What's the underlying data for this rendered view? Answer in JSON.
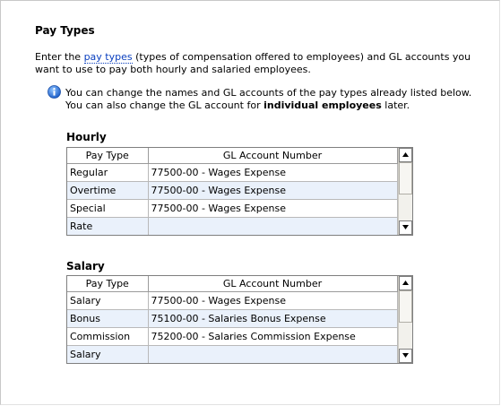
{
  "page": {
    "title": "Pay Types",
    "intro_before_link": "Enter the ",
    "intro_link": "pay types",
    "intro_after_link": " (types of compensation offered to employees) and GL accounts you want to use to pay both hourly and salaried employees.",
    "info_before_bold": "You can change the names and GL accounts of the pay types already listed below. You can also change the GL account for ",
    "info_bold": "individual employees",
    "info_after_bold": " later."
  },
  "hourly": {
    "label": "Hourly",
    "columns": [
      "Pay Type",
      "GL Account Number"
    ],
    "rows": [
      {
        "pay_type": "Regular",
        "gl_account": "77500-00 - Wages Expense"
      },
      {
        "pay_type": "Overtime",
        "gl_account": "77500-00 - Wages Expense"
      },
      {
        "pay_type": "Special",
        "gl_account": "77500-00 - Wages Expense"
      },
      {
        "pay_type": "Rate",
        "gl_account": ""
      }
    ]
  },
  "salary": {
    "label": "Salary",
    "columns": [
      "Pay Type",
      "GL Account Number"
    ],
    "rows": [
      {
        "pay_type": "Salary",
        "gl_account": "77500-00 - Wages Expense"
      },
      {
        "pay_type": "Bonus",
        "gl_account": "75100-00 - Salaries Bonus Expense"
      },
      {
        "pay_type": "Commission",
        "gl_account": "75200-00 - Salaries Commission Expense"
      },
      {
        "pay_type": "Salary",
        "gl_account": ""
      }
    ]
  },
  "icons": {
    "info": "info-icon",
    "scroll_up": "arrow-up-icon",
    "scroll_down": "arrow-down-icon"
  },
  "colors": {
    "link": "#0a3fbf",
    "row_alt": "#eaf1fb",
    "info_icon": "#2f6fd6"
  }
}
